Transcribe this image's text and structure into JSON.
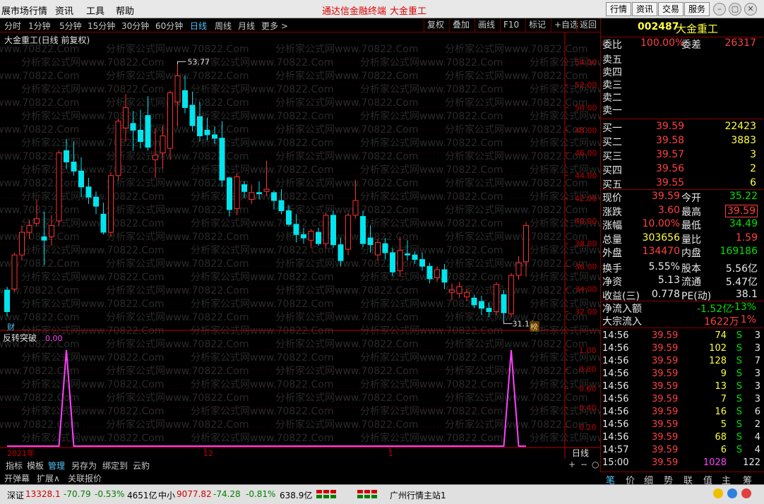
{
  "menubar": {
    "items": [
      "展市场行情",
      "资讯",
      "工具",
      "帮助"
    ],
    "center_title": "通达信金融终端",
    "center_stock": "大金重工",
    "right_buttons": [
      "行情",
      "资讯",
      "交易",
      "服务"
    ]
  },
  "toolbar": {
    "periods": [
      "分时",
      "1分钟",
      "5分钟",
      "15分钟",
      "30分钟",
      "60分钟",
      "日线",
      "周线",
      "月线",
      "更多 >"
    ],
    "active_period": "日线",
    "buttons": [
      "复权",
      "叠加",
      "画线",
      "F10",
      "标记",
      "+自选",
      "返回"
    ]
  },
  "chart": {
    "title": "大金重工(日线 前复权)",
    "watermark": "分析家公式网www.70822.Com",
    "high_label": "53.77",
    "low_label": "31.16",
    "marker_cai": "财",
    "marker_bang": "榜",
    "indicator_title": "反转突破",
    "indicator_value": "0.00",
    "date_labels": [
      "2021年",
      "12",
      "1"
    ],
    "period_label": "日线"
  },
  "chart_data": [
    {
      "type": "candlestick",
      "title": "大金重工(日线 前复权)",
      "y_ticks": [
        32,
        34,
        36,
        38,
        40,
        42,
        44,
        46,
        48,
        50,
        52,
        54
      ],
      "ylim": [
        30.6,
        55.5
      ],
      "candles": [
        {
          "o": 33.9,
          "h": 34.2,
          "l": 31.6,
          "c": 32.0
        },
        {
          "o": 34.0,
          "h": 37.2,
          "l": 33.8,
          "c": 37.0
        },
        {
          "o": 37.0,
          "h": 39.6,
          "l": 36.5,
          "c": 39.0
        },
        {
          "o": 39.0,
          "h": 40.1,
          "l": 38.4,
          "c": 39.6
        },
        {
          "o": 39.8,
          "h": 41.9,
          "l": 39.5,
          "c": 40.2
        },
        {
          "o": 38.6,
          "h": 40.8,
          "l": 36.1,
          "c": 38.3
        },
        {
          "o": 38.6,
          "h": 40.5,
          "l": 37.8,
          "c": 39.6
        },
        {
          "o": 40.0,
          "h": 46.2,
          "l": 39.6,
          "c": 46.0
        },
        {
          "o": 46.2,
          "h": 47.2,
          "l": 44.6,
          "c": 45.2
        },
        {
          "o": 45.2,
          "h": 47.0,
          "l": 44.0,
          "c": 44.4
        },
        {
          "o": 44.4,
          "h": 45.6,
          "l": 42.1,
          "c": 43.0
        },
        {
          "o": 43.0,
          "h": 43.8,
          "l": 41.5,
          "c": 42.1
        },
        {
          "o": 42.1,
          "h": 42.6,
          "l": 40.6,
          "c": 41.3
        },
        {
          "o": 40.6,
          "h": 41.6,
          "l": 38.8,
          "c": 39.0
        },
        {
          "o": 39.0,
          "h": 44.3,
          "l": 38.6,
          "c": 44.0
        },
        {
          "o": 44.0,
          "h": 49.0,
          "l": 43.6,
          "c": 48.8
        },
        {
          "o": 48.2,
          "h": 51.2,
          "l": 47.0,
          "c": 50.0
        },
        {
          "o": 48.6,
          "h": 49.7,
          "l": 46.2,
          "c": 48.0
        },
        {
          "o": 48.0,
          "h": 49.8,
          "l": 46.4,
          "c": 47.0
        },
        {
          "o": 49.3,
          "h": 51.0,
          "l": 46.2,
          "c": 46.5
        },
        {
          "o": 45.4,
          "h": 48.2,
          "l": 43.8,
          "c": 45.8
        },
        {
          "o": 46.0,
          "h": 48.4,
          "l": 44.6,
          "c": 47.5
        },
        {
          "o": 46.4,
          "h": 51.5,
          "l": 45.4,
          "c": 51.3
        },
        {
          "o": 50.5,
          "h": 53.8,
          "l": 48.3,
          "c": 52.8
        },
        {
          "o": 51.5,
          "h": 52.8,
          "l": 49.5,
          "c": 50.0
        },
        {
          "o": 50.2,
          "h": 51.4,
          "l": 47.9,
          "c": 48.4
        },
        {
          "o": 49.2,
          "h": 50.5,
          "l": 47.0,
          "c": 47.5
        },
        {
          "o": 48.0,
          "h": 49.1,
          "l": 47.1,
          "c": 47.6
        },
        {
          "o": 47.6,
          "h": 48.3,
          "l": 46.8,
          "c": 47.3
        },
        {
          "o": 47.3,
          "h": 48.8,
          "l": 43.0,
          "c": 43.6
        },
        {
          "o": 43.8,
          "h": 43.9,
          "l": 40.4,
          "c": 41.0
        },
        {
          "o": 41.1,
          "h": 44.2,
          "l": 40.5,
          "c": 43.9
        },
        {
          "o": 43.2,
          "h": 43.5,
          "l": 42.0,
          "c": 42.6
        },
        {
          "o": 41.9,
          "h": 43.2,
          "l": 41.5,
          "c": 42.5
        },
        {
          "o": 42.5,
          "h": 43.5,
          "l": 41.9,
          "c": 42.4
        },
        {
          "o": 42.6,
          "h": 45.3,
          "l": 42.2,
          "c": 42.8
        },
        {
          "o": 42.5,
          "h": 42.7,
          "l": 41.0,
          "c": 41.8
        },
        {
          "o": 41.8,
          "h": 42.8,
          "l": 40.6,
          "c": 40.9
        },
        {
          "o": 40.9,
          "h": 41.4,
          "l": 39.5,
          "c": 39.7
        },
        {
          "o": 39.7,
          "h": 40.6,
          "l": 38.1,
          "c": 38.8
        },
        {
          "o": 38.8,
          "h": 39.4,
          "l": 38.0,
          "c": 38.5
        },
        {
          "o": 38.3,
          "h": 39.3,
          "l": 37.6,
          "c": 39.1
        },
        {
          "o": 39.0,
          "h": 39.4,
          "l": 37.8,
          "c": 38.0
        },
        {
          "o": 38.0,
          "h": 40.7,
          "l": 37.6,
          "c": 40.5
        },
        {
          "o": 40.5,
          "h": 40.9,
          "l": 37.6,
          "c": 37.9
        },
        {
          "o": 37.9,
          "h": 38.5,
          "l": 36.0,
          "c": 36.5
        },
        {
          "o": 37.5,
          "h": 40.7,
          "l": 37.0,
          "c": 40.5
        },
        {
          "o": 40.5,
          "h": 43.6,
          "l": 40.2,
          "c": 41.8
        },
        {
          "o": 40.4,
          "h": 40.9,
          "l": 37.7,
          "c": 38.0
        },
        {
          "o": 38.5,
          "h": 39.6,
          "l": 37.2,
          "c": 37.9
        },
        {
          "o": 37.0,
          "h": 38.4,
          "l": 36.5,
          "c": 38.1
        },
        {
          "o": 38.0,
          "h": 38.5,
          "l": 36.6,
          "c": 37.2
        },
        {
          "o": 37.2,
          "h": 37.6,
          "l": 35.1,
          "c": 35.5
        },
        {
          "o": 35.6,
          "h": 38.6,
          "l": 35.1,
          "c": 37.4
        },
        {
          "o": 37.1,
          "h": 38.3,
          "l": 36.5,
          "c": 37.0
        },
        {
          "o": 37.0,
          "h": 37.3,
          "l": 36.2,
          "c": 36.6
        },
        {
          "o": 36.6,
          "h": 37.2,
          "l": 35.6,
          "c": 36.0
        },
        {
          "o": 36.0,
          "h": 36.3,
          "l": 34.5,
          "c": 34.9
        },
        {
          "o": 35.0,
          "h": 36.0,
          "l": 34.6,
          "c": 35.7
        },
        {
          "o": 35.7,
          "h": 36.2,
          "l": 34.0,
          "c": 34.6
        },
        {
          "o": 33.7,
          "h": 34.5,
          "l": 33.0,
          "c": 33.9
        },
        {
          "o": 33.6,
          "h": 34.6,
          "l": 33.2,
          "c": 34.2
        },
        {
          "o": 33.3,
          "h": 34.0,
          "l": 32.9,
          "c": 33.7
        },
        {
          "o": 33.2,
          "h": 33.5,
          "l": 32.3,
          "c": 32.6
        },
        {
          "o": 32.9,
          "h": 33.4,
          "l": 31.7,
          "c": 32.3
        },
        {
          "o": 32.3,
          "h": 32.8,
          "l": 31.5,
          "c": 32.0
        },
        {
          "o": 32.0,
          "h": 34.6,
          "l": 31.7,
          "c": 34.4
        },
        {
          "o": 33.5,
          "h": 33.9,
          "l": 31.2,
          "c": 31.9
        },
        {
          "o": 31.8,
          "h": 35.4,
          "l": 31.5,
          "c": 35.2
        },
        {
          "o": 35.2,
          "h": 36.9,
          "l": 34.8,
          "c": 36.3
        },
        {
          "o": 36.4,
          "h": 39.9,
          "l": 35.1,
          "c": 39.6
        }
      ]
    },
    {
      "type": "line",
      "title": "反转突破",
      "y_ticks": [
        0.2,
        0.4,
        0.6,
        0.8,
        1.0
      ],
      "ylim": [
        0,
        1
      ],
      "values": [
        0,
        0,
        0,
        0,
        0,
        0,
        0,
        0,
        0,
        0,
        0,
        0,
        0,
        0,
        0,
        0,
        0,
        0,
        0,
        0,
        0,
        0,
        0,
        0,
        0,
        0,
        0,
        0,
        0,
        0,
        0,
        0,
        0,
        0,
        0,
        0,
        0,
        0,
        0,
        0,
        0,
        0,
        0,
        0,
        0,
        0,
        0,
        0,
        0,
        0,
        0,
        0,
        0,
        0,
        0,
        0,
        0,
        0,
        0,
        0,
        0,
        0,
        0,
        0,
        0,
        0,
        0,
        0,
        0,
        0,
        0
      ],
      "spikes": [
        {
          "index": 8,
          "value": 1.0
        },
        {
          "index": 68,
          "value": 1.0
        }
      ]
    }
  ],
  "quote": {
    "code": "002487",
    "name": "大金重工",
    "weibi_label": "委比",
    "weibi": "100.00%",
    "weicha_label": "委差",
    "weicha": "26317",
    "sell": [
      {
        "label": "卖五",
        "price": "",
        "vol": ""
      },
      {
        "label": "卖四",
        "price": "",
        "vol": ""
      },
      {
        "label": "卖三",
        "price": "",
        "vol": ""
      },
      {
        "label": "卖二",
        "price": "",
        "vol": ""
      },
      {
        "label": "卖一",
        "price": "",
        "vol": ""
      }
    ],
    "buy": [
      {
        "label": "买一",
        "price": "39.59",
        "vol": "22423"
      },
      {
        "label": "买二",
        "price": "39.58",
        "vol": "3883"
      },
      {
        "label": "买三",
        "price": "39.57",
        "vol": "3"
      },
      {
        "label": "买四",
        "price": "39.56",
        "vol": "2"
      },
      {
        "label": "买五",
        "price": "39.55",
        "vol": "6"
      }
    ],
    "stats": [
      {
        "l1": "现价",
        "v1": "39.59",
        "c1": "red",
        "l2": "今开",
        "v2": "35.22",
        "c2": "grn"
      },
      {
        "l1": "涨跌",
        "v1": "3.60",
        "c1": "red",
        "l2": "最高",
        "v2": "39.59",
        "c2": "red"
      },
      {
        "l1": "涨幅",
        "v1": "10.00%",
        "c1": "red",
        "l2": "最低",
        "v2": "34.49",
        "c2": "grn"
      },
      {
        "l1": "总量",
        "v1": "303656",
        "c1": "yel",
        "l2": "量比",
        "v2": "1.59",
        "c2": "red"
      },
      {
        "l1": "外盘",
        "v1": "134470",
        "c1": "red",
        "l2": "内盘",
        "v2": "169186",
        "c2": "grn"
      },
      {
        "l1": "换手",
        "v1": "5.55%",
        "c1": "wht",
        "l2": "股本",
        "v2": "5.56亿",
        "c2": "wht"
      },
      {
        "l1": "净资",
        "v1": "5.13",
        "c1": "wht",
        "l2": "流通",
        "v2": "5.47亿",
        "c2": "wht"
      },
      {
        "l1": "收益(三)",
        "v1": "0.778",
        "c1": "wht",
        "l2": "PE(动)",
        "v2": "38.1",
        "c2": "wht"
      }
    ],
    "netflow_label": "净流入额",
    "netflow": "-1.52亿",
    "netflow_pct": "-13%",
    "bigflow_label": "大宗流入",
    "bigflow": "1622万",
    "bigflow_pct": "1%",
    "ticks": [
      {
        "t": "14:56",
        "p": "39.59",
        "v": "74",
        "s": "S",
        "n": "3"
      },
      {
        "t": "14:56",
        "p": "39.59",
        "v": "102",
        "s": "S",
        "n": "3"
      },
      {
        "t": "14:56",
        "p": "39.59",
        "v": "128",
        "s": "S",
        "n": "7"
      },
      {
        "t": "14:56",
        "p": "39.59",
        "v": "9",
        "s": "S",
        "n": "3"
      },
      {
        "t": "14:56",
        "p": "39.59",
        "v": "13",
        "s": "S",
        "n": "3"
      },
      {
        "t": "14:56",
        "p": "39.59",
        "v": "7",
        "s": "S",
        "n": "3"
      },
      {
        "t": "14:56",
        "p": "39.59",
        "v": "16",
        "s": "S",
        "n": "6"
      },
      {
        "t": "14:56",
        "p": "39.59",
        "v": "5",
        "s": "S",
        "n": "2"
      },
      {
        "t": "14:56",
        "p": "39.59",
        "v": "68",
        "s": "S",
        "n": "4"
      },
      {
        "t": "14:57",
        "p": "39.59",
        "v": "6",
        "s": "S",
        "n": "4"
      },
      {
        "t": "15:00",
        "p": "39.59",
        "v": "1028",
        "s": "",
        "n": "122"
      }
    ],
    "tabs": [
      "笔",
      "价",
      "细",
      "势",
      "联",
      "值",
      "主",
      "筹"
    ]
  },
  "bottomtabs": [
    "指标",
    "模板",
    "管理",
    "另存为",
    "绑定到",
    "云豹"
  ],
  "subtabs": [
    "开弹幕",
    "扩展∧",
    "关联报价"
  ],
  "statusbar": {
    "sz_label": "深证",
    "sz_value": "13328.1",
    "sz_change": "-70.79",
    "sz_pct": "-0.53%",
    "sz_amount": "4651亿",
    "zx_label": "中小",
    "zx_value": "9077.82",
    "zx_change": "-74.28",
    "zx_pct": "-0.81%",
    "zx_amount": "638.9亿",
    "server": "广州行情主站1"
  },
  "colors": {
    "up": "#ff3030",
    "down": "#00e5ee",
    "grid": "#800000",
    "axis": "#c00000",
    "indicator": "#ff40ff"
  }
}
